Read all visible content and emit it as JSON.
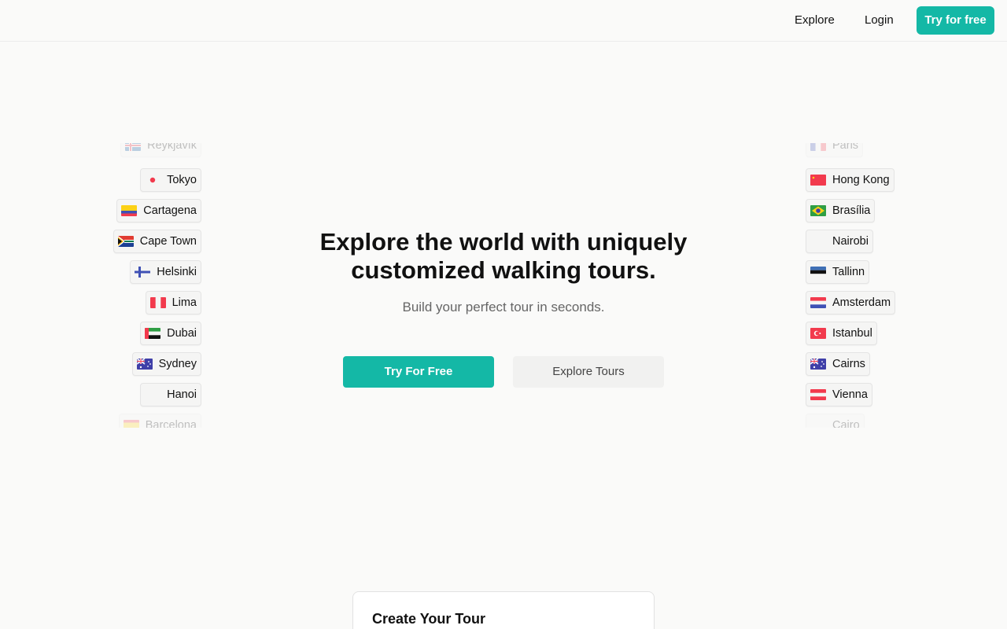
{
  "nav": {
    "explore": "Explore",
    "login": "Login",
    "cta": "Try for free"
  },
  "hero": {
    "title_line1": "Explore the world with uniquely",
    "title_line2": "customized walking tours.",
    "subtitle": "Build your perfect tour in seconds.",
    "primary_button": "Try For Free",
    "secondary_button": "Explore Tours"
  },
  "cities_left": [
    {
      "name": "Reykjavík",
      "flag": "iceland-flag-icon"
    },
    {
      "name": "Tokyo",
      "flag": "japan-flag-icon"
    },
    {
      "name": "Cartagena",
      "flag": "colombia-flag-icon"
    },
    {
      "name": "Cape Town",
      "flag": "south-africa-flag-icon"
    },
    {
      "name": "Helsinki",
      "flag": "finland-flag-icon"
    },
    {
      "name": "Lima",
      "flag": "peru-flag-icon"
    },
    {
      "name": "Dubai",
      "flag": "uae-flag-icon"
    },
    {
      "name": "Sydney",
      "flag": "australia-flag-icon"
    },
    {
      "name": "Hanoi",
      "flag": "vietnam-flag-icon"
    },
    {
      "name": "Barcelona",
      "flag": "spain-flag-icon"
    }
  ],
  "cities_right": [
    {
      "name": "Paris",
      "flag": "france-flag-icon"
    },
    {
      "name": "Hong Kong",
      "flag": "china-flag-icon"
    },
    {
      "name": "Brasília",
      "flag": "brazil-flag-icon"
    },
    {
      "name": "Nairobi",
      "flag": "kenya-flag-icon"
    },
    {
      "name": "Tallinn",
      "flag": "estonia-flag-icon"
    },
    {
      "name": "Amsterdam",
      "flag": "netherlands-flag-icon"
    },
    {
      "name": "Istanbul",
      "flag": "turkey-flag-icon"
    },
    {
      "name": "Cairns",
      "flag": "australia-flag-icon"
    },
    {
      "name": "Vienna",
      "flag": "austria-flag-icon"
    },
    {
      "name": "Cairo",
      "flag": "egypt-flag-icon"
    }
  ],
  "card": {
    "title": "Create Your Tour"
  },
  "colors": {
    "accent": "#14b8a6",
    "background": "#fafaf9"
  }
}
